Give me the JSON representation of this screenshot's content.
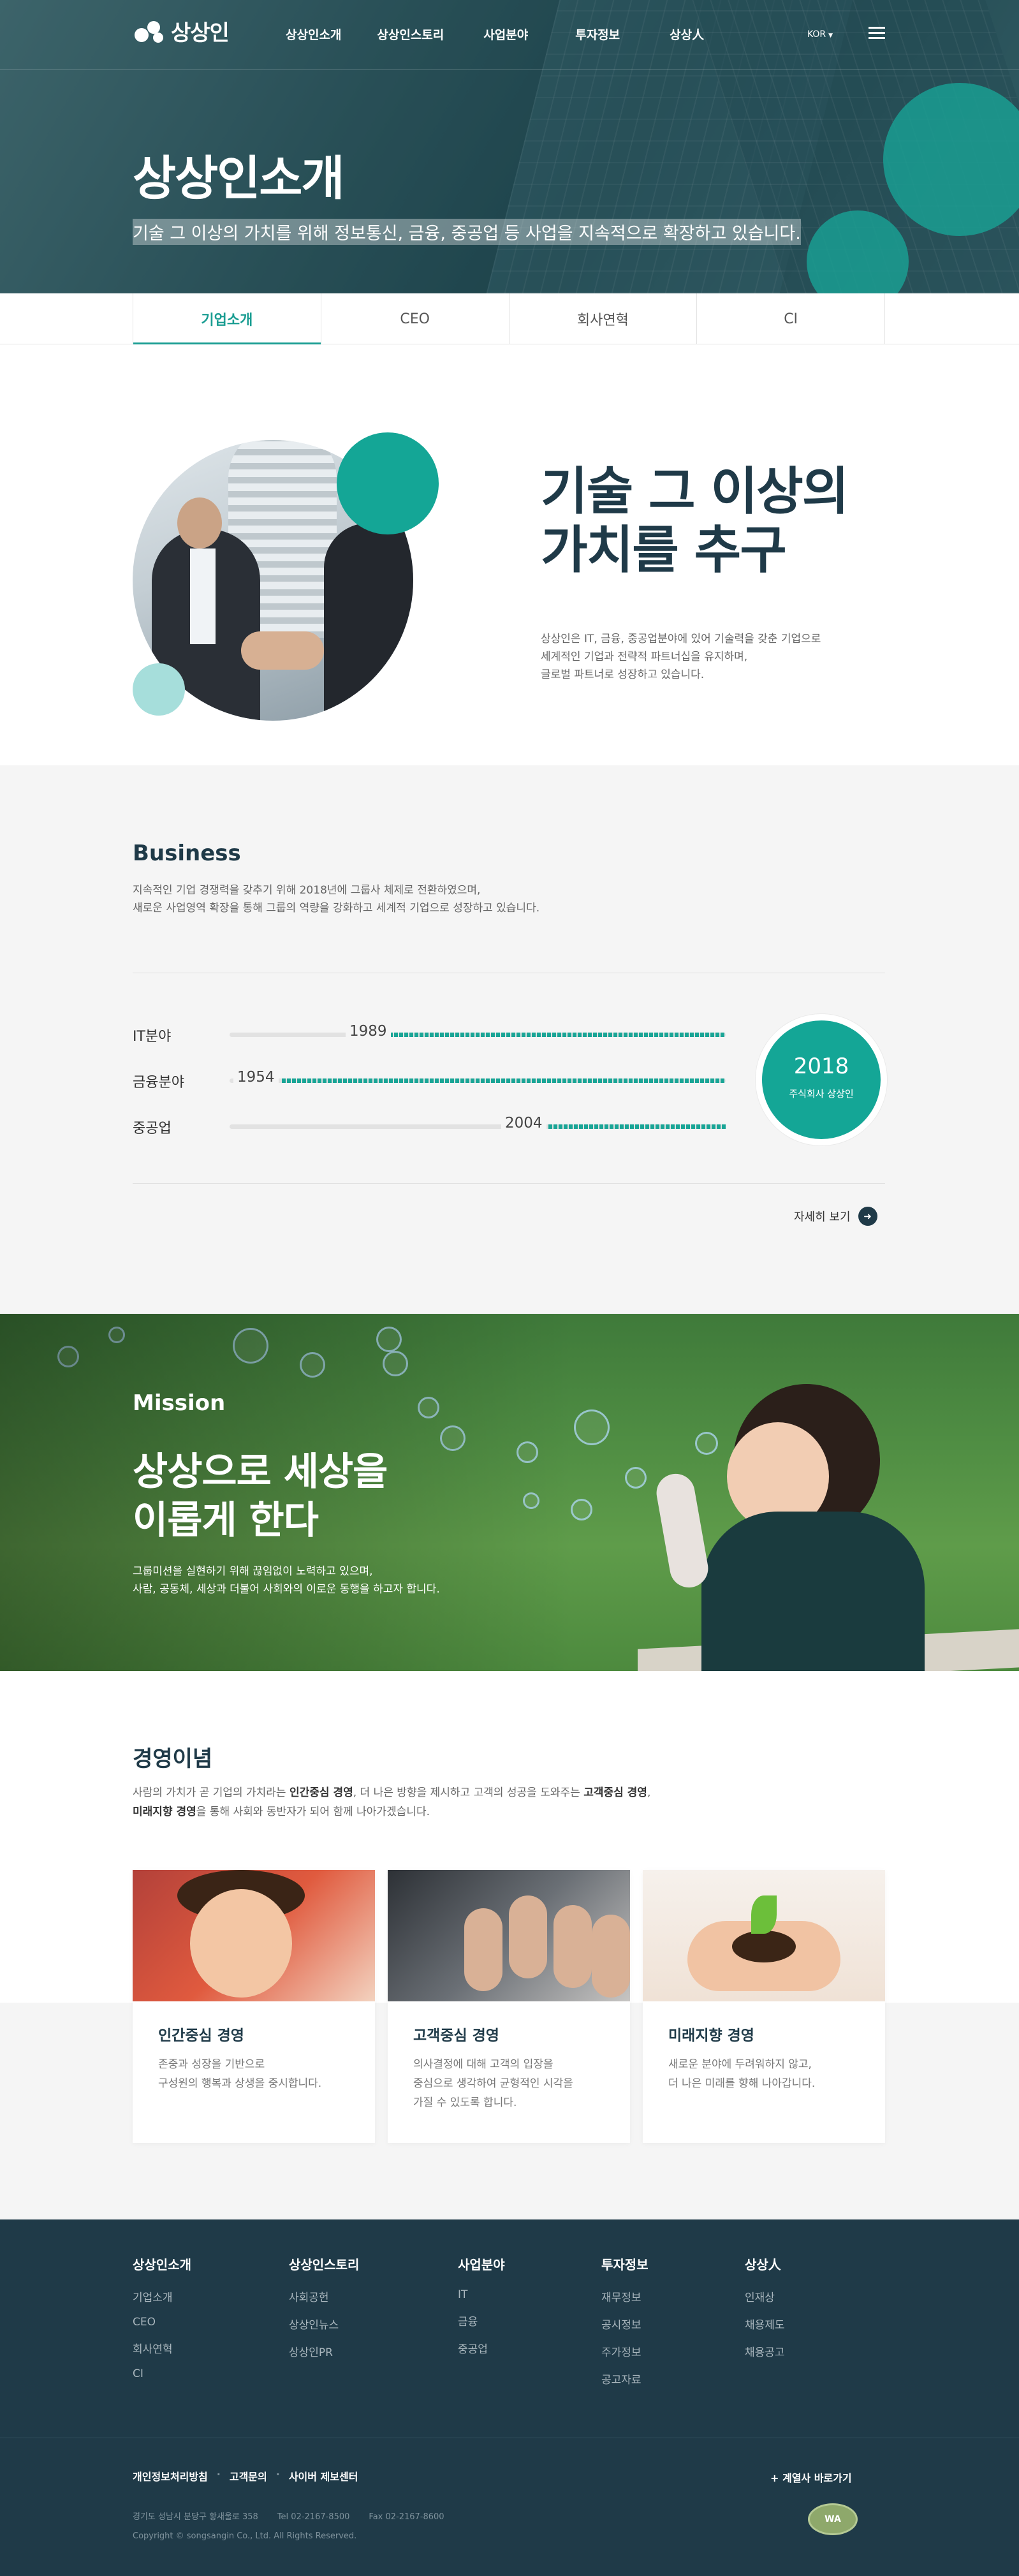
{
  "header": {
    "logo_text": "상상인",
    "nav": [
      "상상인소개",
      "상상인스토리",
      "사업분야",
      "투자정보",
      "상상人"
    ],
    "lang": "KOR",
    "lang_icon": "caret-down-icon",
    "menu_icon": "hamburger-icon"
  },
  "hero": {
    "title": "상상인소개",
    "subtitle": "기술 그 이상의 가치를 위해 정보통신, 금융, 중공업 등 사업을 지속적으로 확장하고 있습니다."
  },
  "tabs": [
    "기업소개",
    "CEO",
    "회사연혁",
    "CI"
  ],
  "intro": {
    "heading_line1": "기술 그 이상의",
    "heading_line2": "가치를 추구",
    "desc_line1": "상상인은 IT, 금융, 중공업분야에 있어 기술력을 갖춘 기업으로",
    "desc_line2": "세계적인 기업과 전략적 파트너십을 유지하며,",
    "desc_line3": "글로벌 파트너로 성장하고 있습니다."
  },
  "business": {
    "title": "Business",
    "desc_line1": "지속적인 기업 경쟁력을 갖추기 위해 2018년에 그룹사 체제로 전환하였으며,",
    "desc_line2": "새로운 사업영역 확장을 통해 그룹의 역량을 강화하고 세계적 기업으로 성장하고 있습니다.",
    "rows": [
      {
        "label": "IT분야",
        "year": "1989"
      },
      {
        "label": "금융분야",
        "year": "1954"
      },
      {
        "label": "중공업",
        "year": "2004"
      }
    ],
    "badge_year": "2018",
    "badge_text": "주식회사 상상인",
    "more_label": "자세히 보기",
    "more_icon": "arrow-right-icon"
  },
  "mission": {
    "label": "Mission",
    "title_line1": "상상으로 세상을",
    "title_line2": "이롭게 한다",
    "desc_line1": "그룹미션을 실현하기 위해 끊임없이 노력하고 있으며,",
    "desc_line2": "사람, 공동체, 세상과 더불어 사회와의 이로운 동행을 하고자 합니다."
  },
  "philosophy": {
    "title": "경영이념",
    "desc_a": "사람의 가치가 곧 기업의 가치라는 ",
    "desc_b": "인간중심 경영",
    "desc_c": ", 더 나은 방향을 제시하고 고객의 성공을 도와주는 ",
    "desc_d": "고객중심 경영",
    "desc_e": ",",
    "desc_f": "미래지향 경영",
    "desc_g": "을 통해 사회와 동반자가 되어 함께 나아가겠습니다.",
    "cards": [
      {
        "title": "인간중심 경영",
        "line1": "존중과 성장을 기반으로",
        "line2": "구성원의 행복과 상생을 중시합니다.",
        "line3": ""
      },
      {
        "title": "고객중심 경영",
        "line1": "의사결정에 대해 고객의 입장을",
        "line2": "중심으로 생각하여 균형적인 시각을",
        "line3": "가질 수 있도록 합니다."
      },
      {
        "title": "미래지향 경영",
        "line1": "새로운 분야에 두려워하지 않고,",
        "line2": "더 나은 미래를 향해 나아갑니다.",
        "line3": ""
      }
    ]
  },
  "footer": {
    "columns": [
      {
        "title": "상상인소개",
        "items": [
          "기업소개",
          "CEO",
          "회사연혁",
          "CI"
        ]
      },
      {
        "title": "상상인스토리",
        "items": [
          "사회공헌",
          "상상인뉴스",
          "상상인PR"
        ]
      },
      {
        "title": "사업분야",
        "items": [
          "IT",
          "금융",
          "중공업"
        ]
      },
      {
        "title": "투자정보",
        "items": [
          "재무정보",
          "공시정보",
          "주가정보",
          "공고자료"
        ]
      },
      {
        "title": "상상人",
        "items": [
          "인재상",
          "채용제도",
          "채용공고"
        ]
      }
    ],
    "links": [
      "개인정보처리방침",
      "고객문의",
      "사이버 제보센터"
    ],
    "family_site": "+ 계열사 바로가기",
    "address": "경기도 성남시 분당구 황새울로 358",
    "tel": "Tel 02-2167-8500",
    "fax": "Fax 02-2167-8600",
    "copyright": "Copyright © songsangin Co., Ltd. All Rights Reserved.",
    "cert_text": "WA"
  }
}
